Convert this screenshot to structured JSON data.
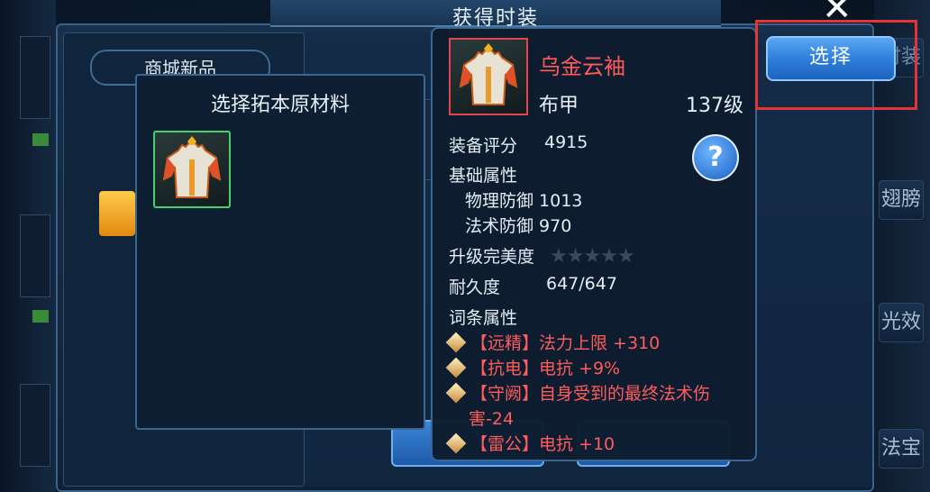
{
  "window": {
    "title": "获得时装"
  },
  "shop": {
    "title": "商城新品"
  },
  "material_panel": {
    "title": "选择拓本原材料"
  },
  "item": {
    "name": "乌金云袖",
    "type": "布甲",
    "level": "137级",
    "score_label": "装备评分",
    "score_value": "4915",
    "base_label": "基础属性",
    "phys_def": "物理防御 1013",
    "mag_def": "法术防御 970",
    "upgrade_label": "升级完美度",
    "stars": "★★★★★",
    "durability_label": "耐久度",
    "durability_value": "647/647",
    "affix_label": "词条属性",
    "affixes": [
      "【远精】法力上限 +310",
      "【抗电】电抗 +9%",
      "【守阙】自身受到的最终法术伤",
      "害-24",
      "【雷公】电抗 +10"
    ]
  },
  "help_label": "?",
  "select_button": "选择",
  "close_label": "✕",
  "side_tabs": [
    "时装",
    "翅膀",
    "光效",
    "法宝"
  ],
  "colors": {
    "item_name": "#ff5a5a",
    "affix": "#ff5c5c",
    "select_button": "#2f7fdc",
    "highlight_outline": "#e23636",
    "selected_border": "#48d06a"
  }
}
